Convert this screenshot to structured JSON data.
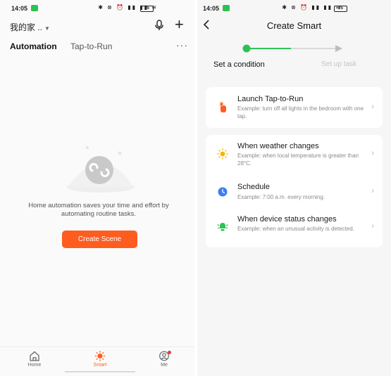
{
  "left_screen": {
    "status_time": "14:05",
    "battery": "25",
    "home_selector": "我的家 ..",
    "tabs": {
      "automation": "Automation",
      "tap_to_run": "Tap-to-Run"
    },
    "more": "···",
    "empty_message": "Home automation saves your time and effort by automating routine tasks.",
    "create_scene_label": "Create Scene",
    "nav": {
      "home": "Home",
      "smart": "Smart",
      "me": "Me"
    }
  },
  "right_screen": {
    "status_time": "14:05",
    "battery": "25",
    "title": "Create Smart",
    "steps": {
      "current": "Set a condition",
      "next": "Set up task"
    },
    "progress": 0.5,
    "options": [
      {
        "icon": "tap-hand-icon",
        "title": "Launch Tap-to-Run",
        "desc": "Example: turn off all lights in the bedroom with one tap."
      },
      {
        "icon": "sun-icon",
        "title": "When weather changes",
        "desc": "Example: when local temperature is greater than 28°C."
      },
      {
        "icon": "clock-icon",
        "title": "Schedule",
        "desc": "Example: 7:00 a.m. every morning."
      },
      {
        "icon": "device-icon",
        "title": "When device status changes",
        "desc": "Example: when an unusual activity is detected."
      }
    ]
  },
  "colors": {
    "accent": "#ff5c1f",
    "progress": "#2bc255",
    "weather": "#f7b500",
    "schedule": "#3d7ff0",
    "device": "#2bc255"
  }
}
